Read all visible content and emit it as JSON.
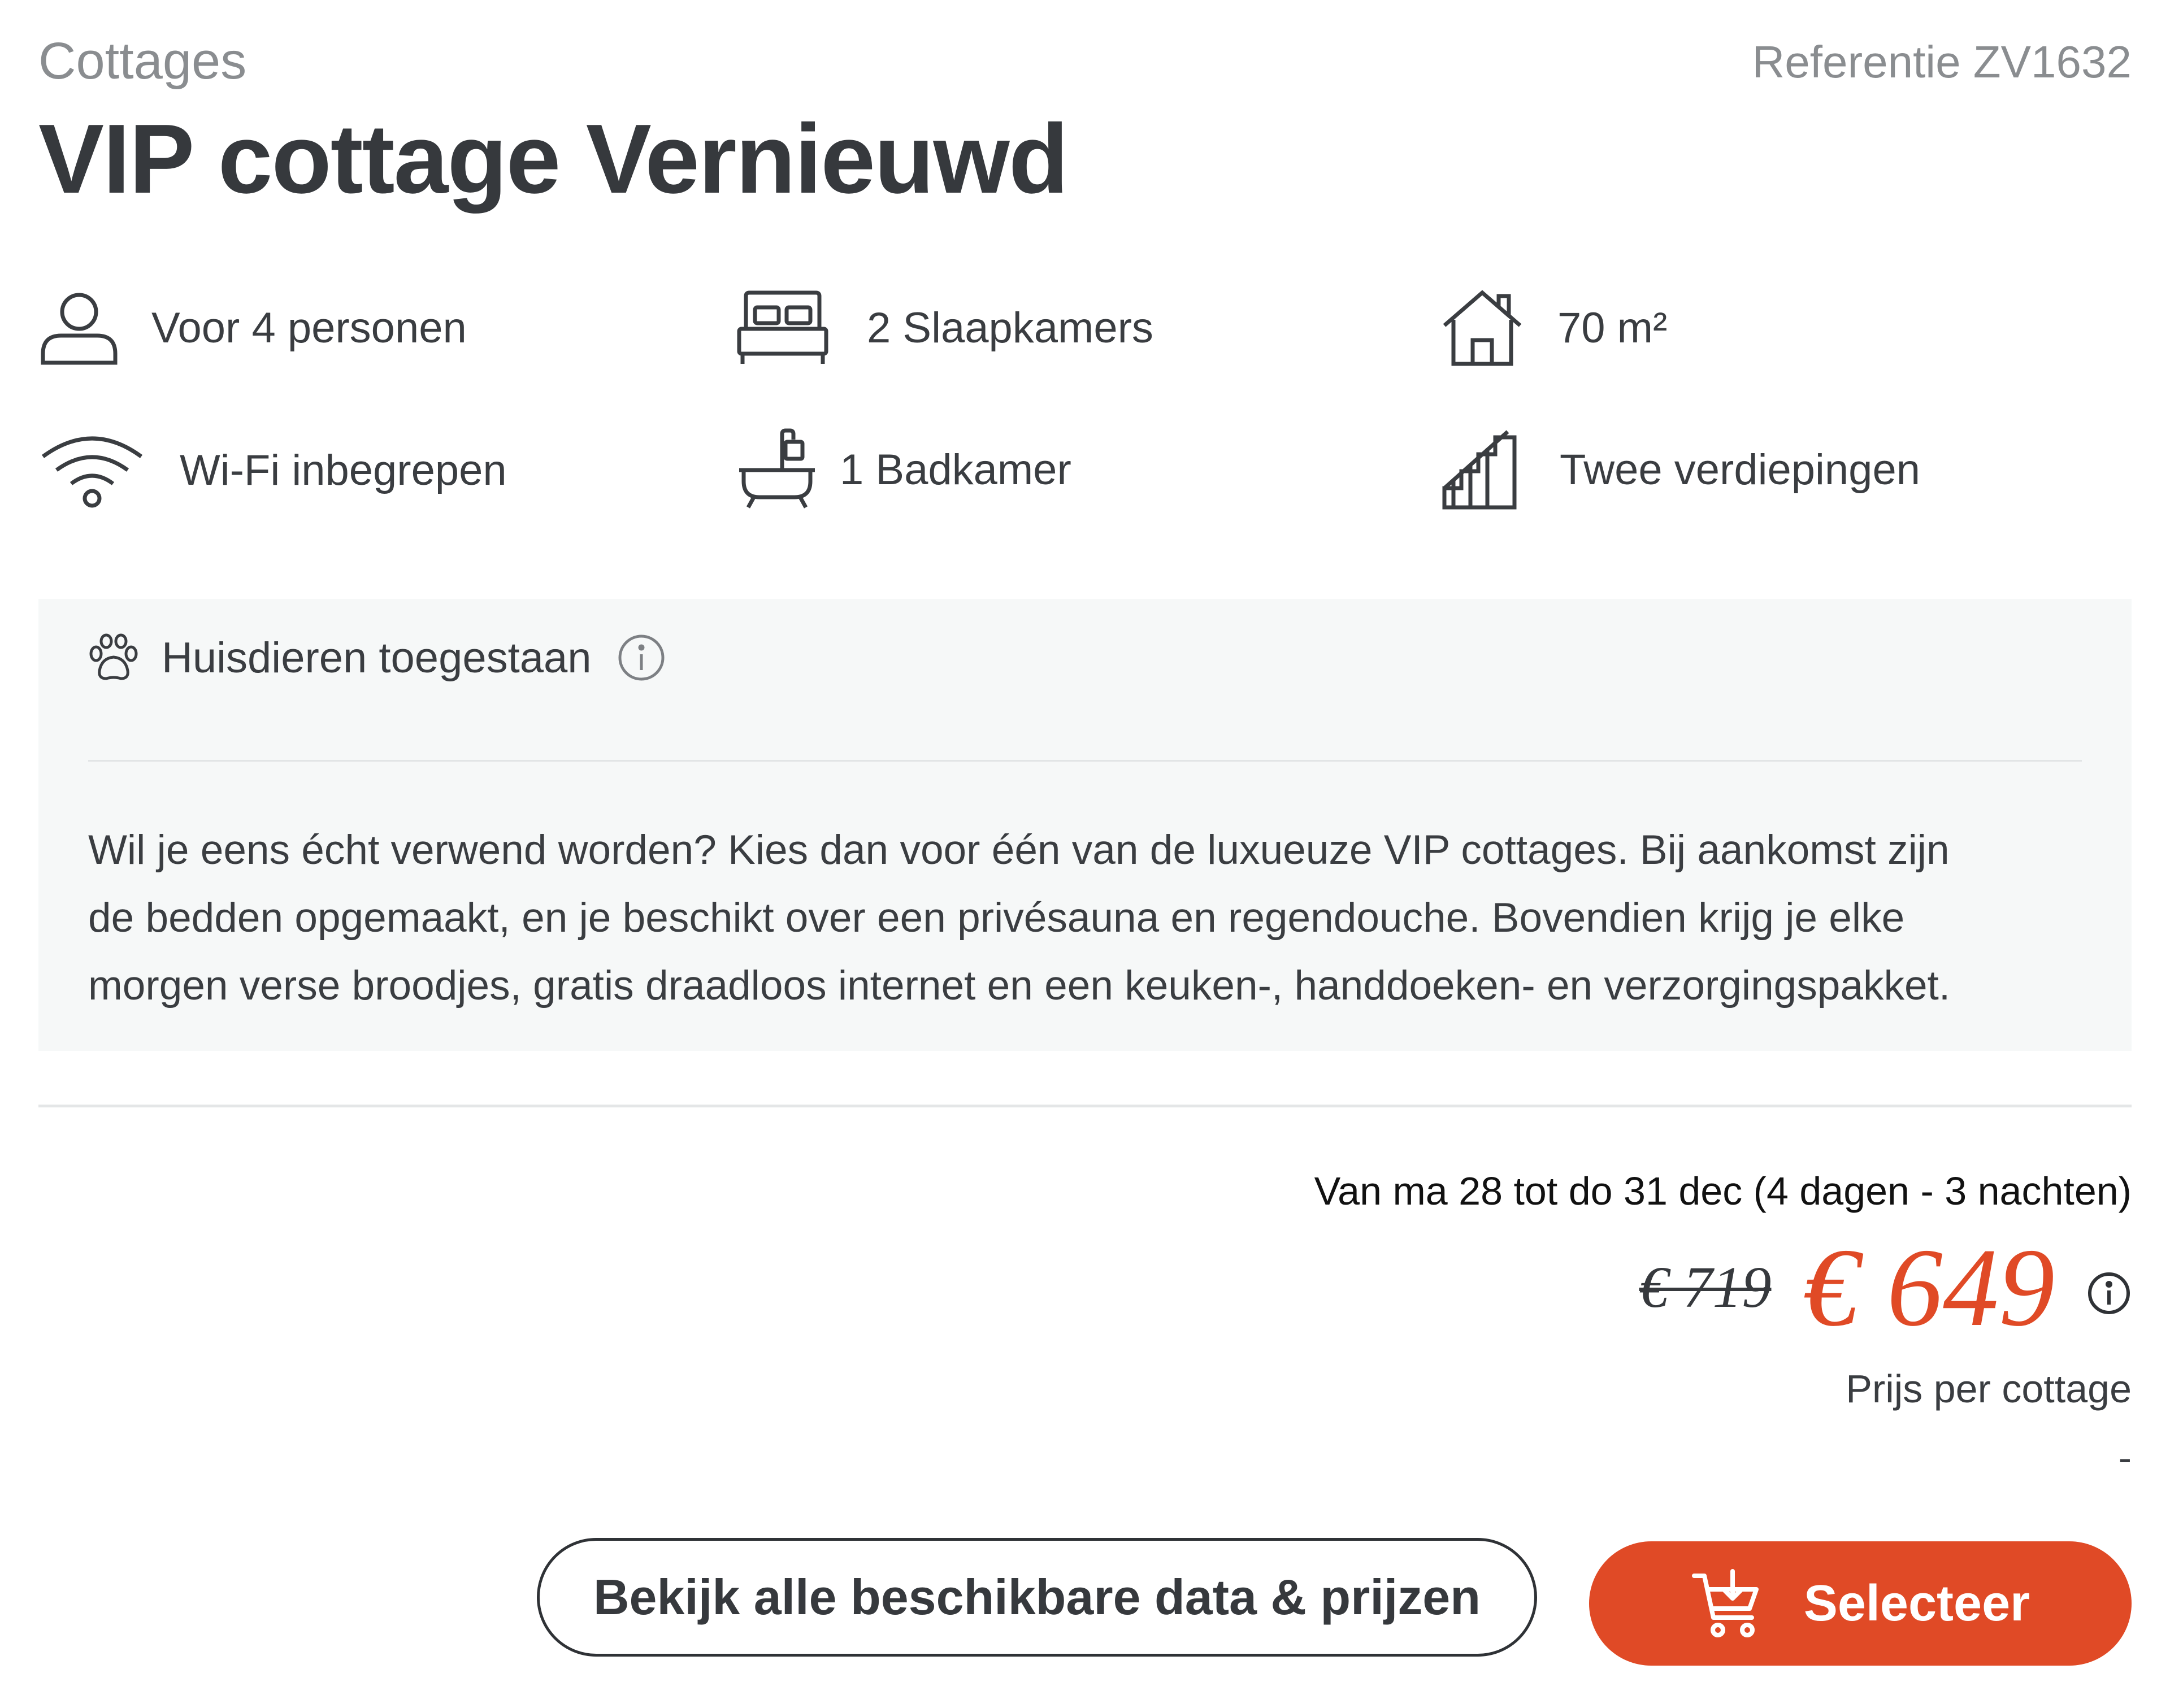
{
  "header": {
    "category": "Cottages",
    "reference": "Referentie ZV1632",
    "title": "VIP cottage Vernieuwd"
  },
  "features": [
    {
      "icon": "person-icon",
      "label": "Voor 4 personen"
    },
    {
      "icon": "bed-icon",
      "label": "2 Slaapkamers"
    },
    {
      "icon": "house-icon",
      "label": "70 m²"
    },
    {
      "icon": "wifi-icon",
      "label": "Wi-Fi inbegrepen"
    },
    {
      "icon": "bathtub-icon",
      "label": "1 Badkamer"
    },
    {
      "icon": "stairs-icon",
      "label": "Twee verdiepingen"
    }
  ],
  "pets": {
    "icon": "paw-icon",
    "label": "Huisdieren toegestaan"
  },
  "description": [
    "Wil je eens écht verwend worden? Kies dan voor één van de luxueuze VIP cottages. Bij aankomst zijn",
    "de bedden opgemaakt, en je beschikt over een privésauna en regendouche. Bovendien krijg je elke",
    "morgen verse broodjes, gratis draadloos internet en een keuken-, handdoeken- en verzorgingspakket."
  ],
  "pricing": {
    "dates": "Van ma 28 tot do 31 dec (4 dagen - 3 nachten)",
    "old_price": "€ 719",
    "new_price": "€ 649",
    "per_unit": "Prijs per cottage",
    "extra": "-"
  },
  "actions": {
    "dates_button": "Bekijk alle beschikbare data & prijzen",
    "select_button": "Selecteer"
  },
  "colors": {
    "accent": "#e04a26",
    "text": "#36393d",
    "muted": "#8a8d90",
    "panel": "#f6f8f8"
  }
}
